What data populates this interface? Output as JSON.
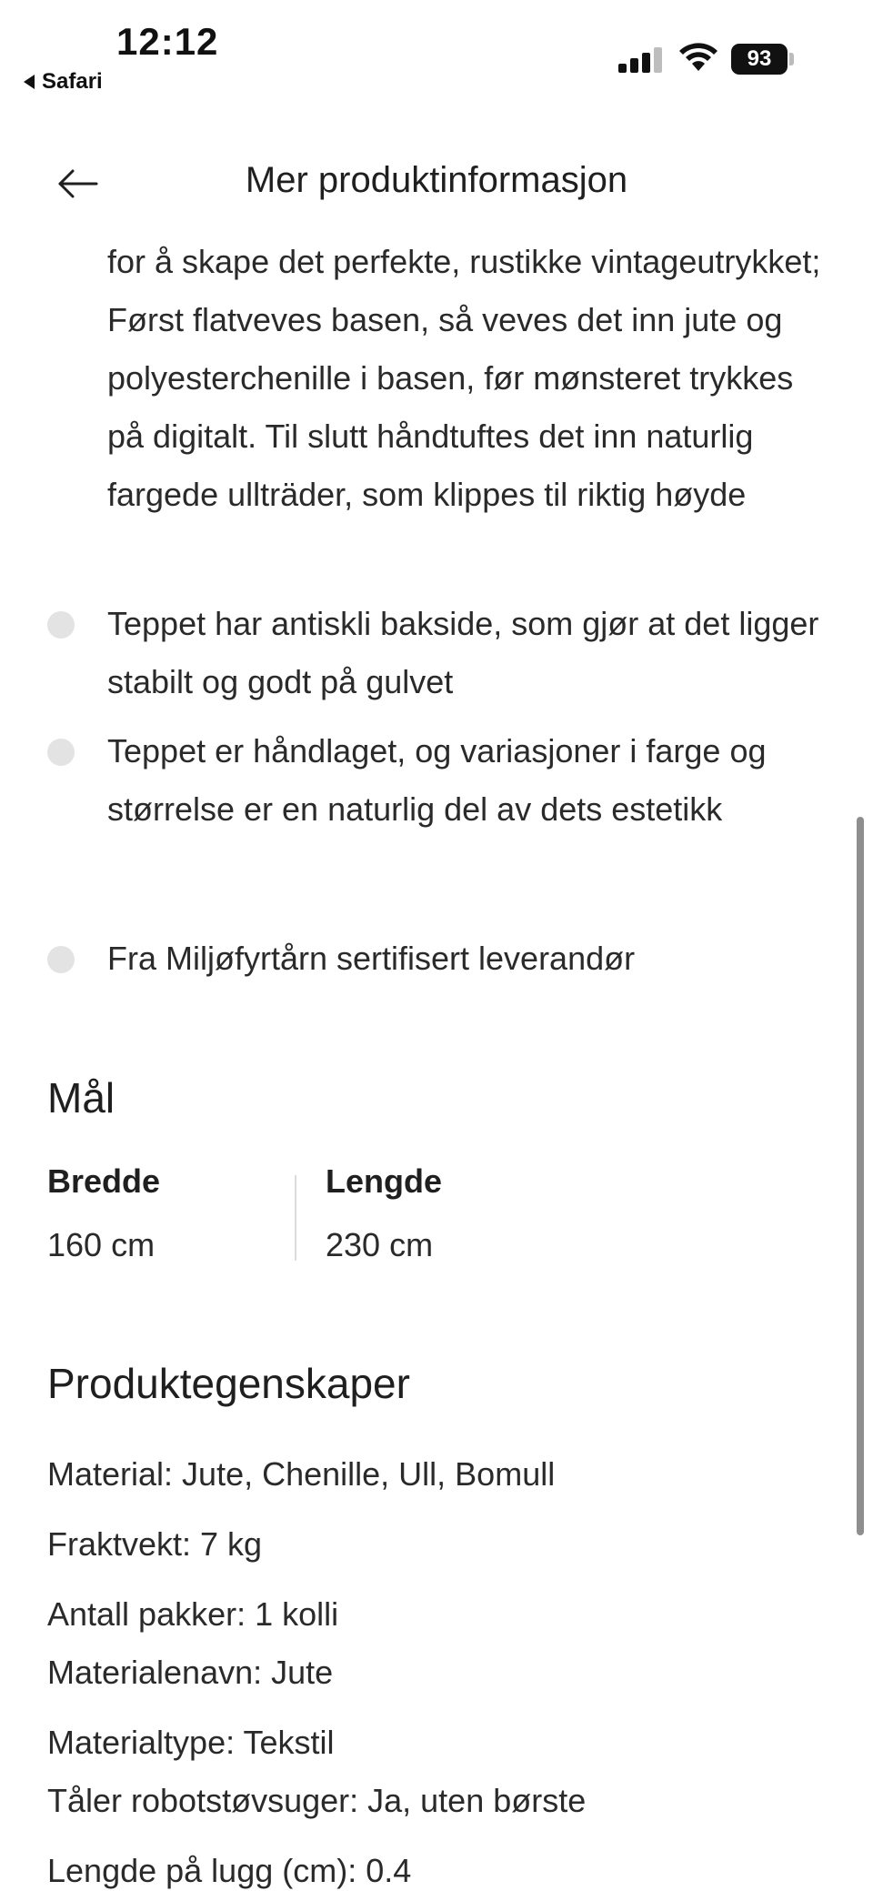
{
  "status_bar": {
    "time": "12:12",
    "back_app": "Safari",
    "battery": "93"
  },
  "header": {
    "title": "Mer produktinformasjon"
  },
  "description": {
    "continued_text": "for å skape det perfekte, rustikke vintageutrykket; Først flatveves basen, så veves det inn jute og polyesterchenille i basen, før mønsteret trykkes på digitalt. Til slutt håndtuftes det inn naturlig fargede ullträder, som klippes til riktig høyde",
    "bullets": [
      "Teppet har antiskli bakside, som gjør at det ligger stabilt og godt på gulvet",
      "Teppet er håndlaget, og variasjoner i farge og størrelse er en naturlig del av dets estetikk",
      "Fra Miljøfyrtårn sertifisert leverandør"
    ]
  },
  "dimensions": {
    "title": "Mål",
    "width_label": "Bredde",
    "width_value": "160 cm",
    "length_label": "Lengde",
    "length_value": "230 cm"
  },
  "properties": {
    "title": "Produktegenskaper",
    "items": [
      "Material: Jute, Chenille, Ull, Bomull",
      "Fraktvekt: 7 kg",
      "Antall pakker: 1 kolli",
      "Materialenavn: Jute",
      "Materialtype: Tekstil",
      "Tåler robotstøvsuger: Ja, uten børste",
      "Lengde på lugg (cm): 0.4"
    ]
  },
  "icons": {
    "back": "arrow-left-icon",
    "signal": "cellular-signal-icon",
    "wifi": "wifi-icon",
    "battery": "battery-icon"
  },
  "colors": {
    "text": "#1f1f1f",
    "bullet": "#e3e3e3",
    "divider": "#dcdcdc"
  }
}
